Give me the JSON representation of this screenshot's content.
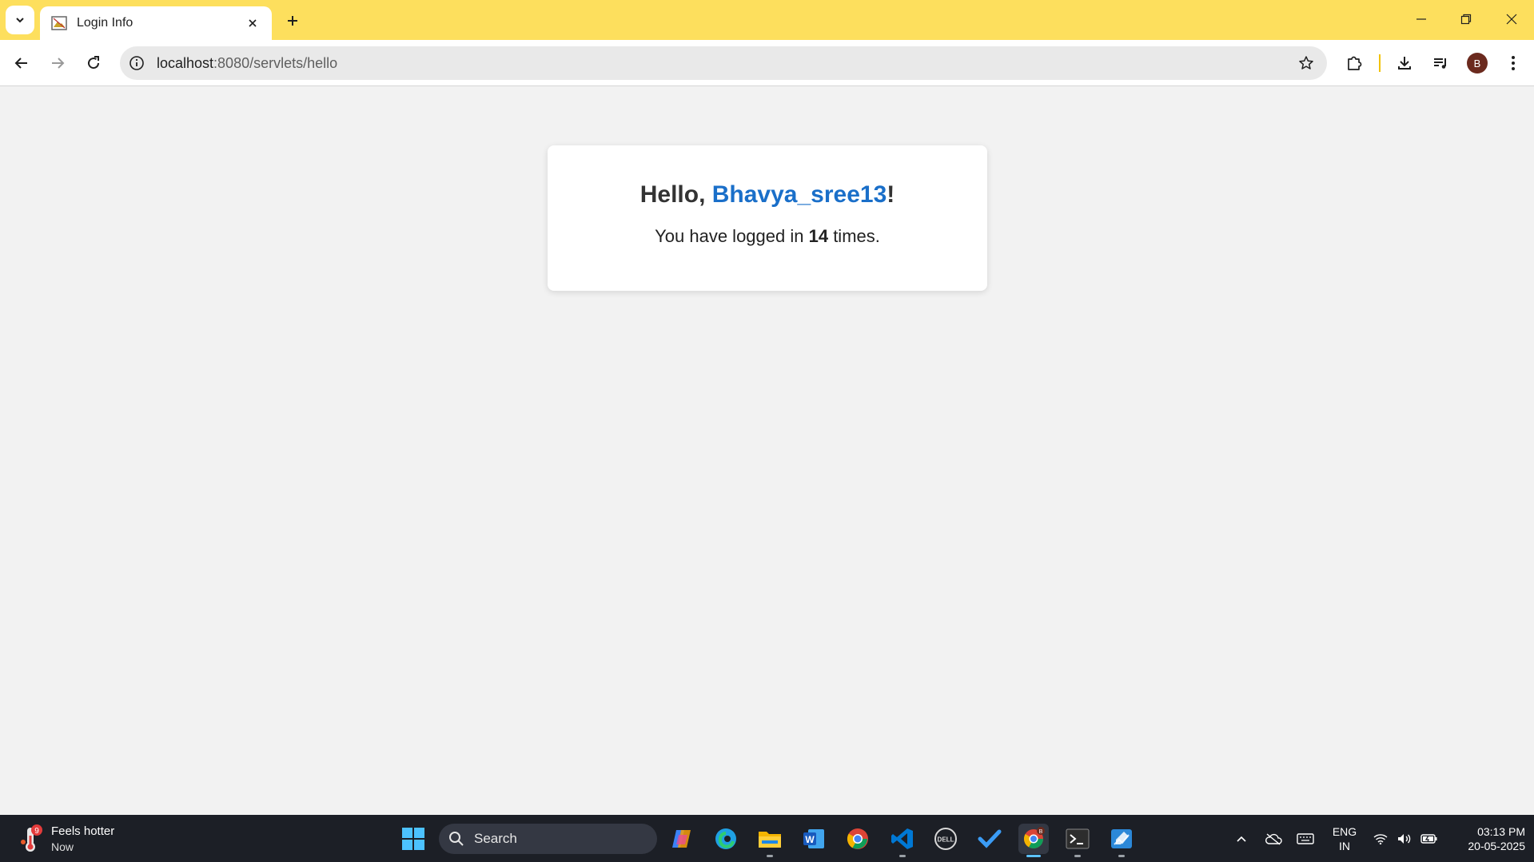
{
  "browser": {
    "tab": {
      "title": "Login Info"
    },
    "address": {
      "host": "localhost",
      "rest": ":8080/servlets/hello"
    },
    "profile_initial": "B",
    "accent_color": "#fddf5d"
  },
  "page": {
    "greeting_prefix": "Hello, ",
    "username": "Bhavya_sree13",
    "greeting_suffix": "!",
    "login_prefix": "You have logged in ",
    "login_count": "14",
    "login_suffix": " times.",
    "username_color": "#1a6fc9"
  },
  "taskbar": {
    "weather": {
      "badge": "9",
      "line1": "Feels hotter",
      "line2": "Now"
    },
    "search_label": "Search",
    "pinned": [
      "copilot-icon",
      "edge-icon",
      "file-explorer-icon",
      "word-icon",
      "chrome-icon",
      "vscode-icon",
      "dell-icon",
      "todo-icon",
      "chrome-profile-icon",
      "terminal-icon",
      "paint-icon"
    ],
    "lang": {
      "line1": "ENG",
      "line2": "IN"
    },
    "clock": {
      "time": "03:13 PM",
      "date": "20-05-2025"
    }
  }
}
